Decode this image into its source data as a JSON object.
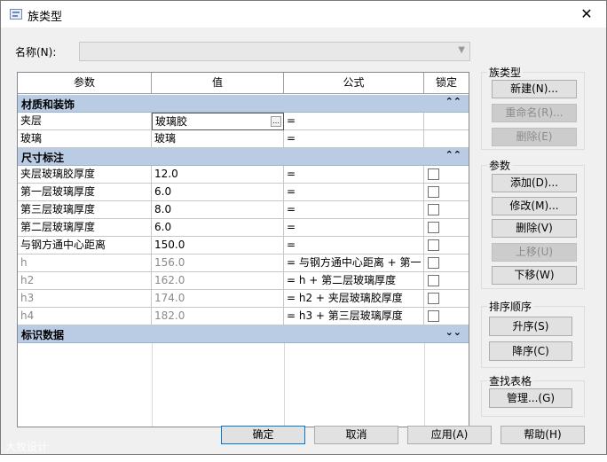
{
  "window": {
    "title": "族类型",
    "close": "✕"
  },
  "name_field": {
    "label": "名称(N):",
    "value": ""
  },
  "grid": {
    "headers": [
      "参数",
      "值",
      "公式",
      "锁定"
    ],
    "groups": [
      {
        "label": "材质和装饰",
        "chevron": "⌃⌃",
        "rows": [
          {
            "param": "夹层",
            "value": "玻璃胶",
            "formula": "=",
            "editing": true,
            "readonly": false,
            "lock": false
          },
          {
            "param": "玻璃",
            "value": "玻璃",
            "formula": "=",
            "readonly": false,
            "lock": false
          }
        ]
      },
      {
        "label": "尺寸标注",
        "chevron": "⌃⌃",
        "rows": [
          {
            "param": "夹层玻璃胶厚度",
            "value": "12.0",
            "formula": "=",
            "readonly": false,
            "lock": true
          },
          {
            "param": "第一层玻璃厚度",
            "value": "6.0",
            "formula": "=",
            "readonly": false,
            "lock": true
          },
          {
            "param": "第三层玻璃厚度",
            "value": "8.0",
            "formula": "=",
            "readonly": false,
            "lock": true
          },
          {
            "param": "第二层玻璃厚度",
            "value": "6.0",
            "formula": "=",
            "readonly": false,
            "lock": true
          },
          {
            "param": "与钢方通中心距离",
            "value": "150.0",
            "formula": "=",
            "readonly": false,
            "lock": true
          },
          {
            "param": "h",
            "value": "156.0",
            "formula": "= 与钢方通中心距离 + 第一",
            "readonly": true,
            "lock": true
          },
          {
            "param": "h2",
            "value": "162.0",
            "formula": "= h + 第二层玻璃厚度",
            "readonly": true,
            "lock": true
          },
          {
            "param": "h3",
            "value": "174.0",
            "formula": "= h2 + 夹层玻璃胶厚度",
            "readonly": true,
            "lock": true
          },
          {
            "param": "h4",
            "value": "182.0",
            "formula": "= h3 + 第三层玻璃厚度",
            "readonly": true,
            "lock": true
          }
        ]
      },
      {
        "label": "标识数据",
        "chevron": "⌄⌄",
        "rows": []
      }
    ]
  },
  "family_types": {
    "title": "族类型",
    "new": "新建(N)...",
    "rename": "重命名(R)...",
    "delete": "删除(E)"
  },
  "parameters": {
    "title": "参数",
    "add": "添加(D)...",
    "modify": "修改(M)...",
    "delete": "删除(V)",
    "move_up": "上移(U)",
    "move_down": "下移(W)"
  },
  "sort_order": {
    "title": "排序顺序",
    "ascending": "升序(S)",
    "descending": "降序(C)"
  },
  "lookup_tables": {
    "title": "查找表格",
    "manage": "管理...(G)"
  },
  "footer": {
    "ok": "确定",
    "cancel": "取消",
    "apply": "应用(A)",
    "help": "帮助(H)"
  },
  "watermark": "大牧设计"
}
